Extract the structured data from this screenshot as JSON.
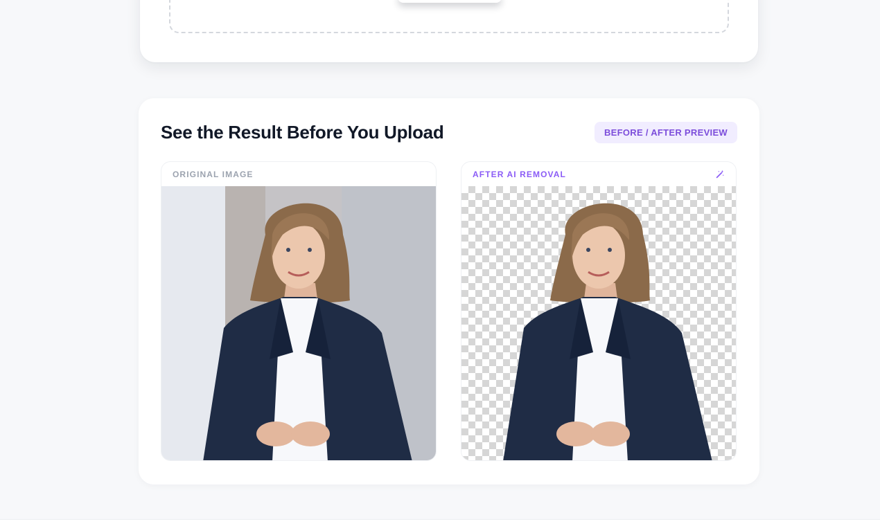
{
  "upload": {},
  "preview": {
    "title": "See the Result Before You Upload",
    "badge": "BEFORE / AFTER PREVIEW",
    "original": {
      "label": "ORIGINAL IMAGE"
    },
    "after": {
      "label": "AFTER AI REMOVAL",
      "icon": "magic-wand-icon"
    }
  },
  "colors": {
    "accent": "#8b5cf6",
    "badge_bg": "#f1edff",
    "page_bg": "#f7f8fa"
  }
}
